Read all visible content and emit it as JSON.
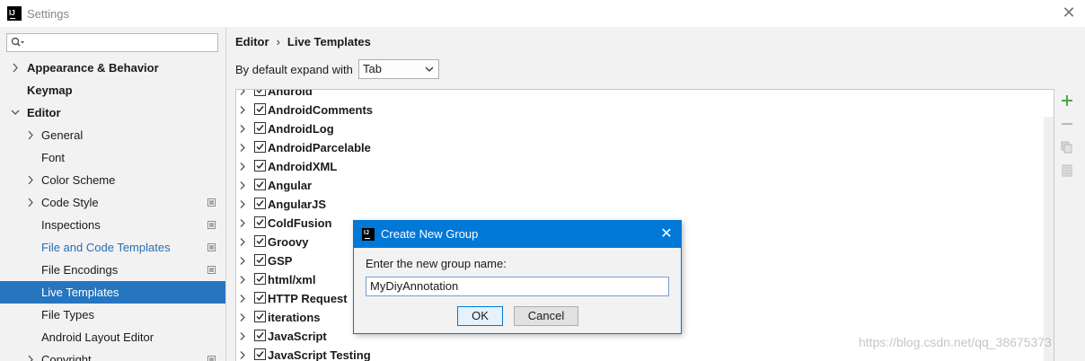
{
  "window": {
    "title": "Settings"
  },
  "sidebar": {
    "search_placeholder": "",
    "items": [
      {
        "label": "Appearance & Behavior",
        "bold": true,
        "expandable": true,
        "expanded": false,
        "indent": 0
      },
      {
        "label": "Keymap",
        "bold": true,
        "expandable": false,
        "indent": 0
      },
      {
        "label": "Editor",
        "bold": true,
        "expandable": true,
        "expanded": true,
        "indent": 0
      },
      {
        "label": "General",
        "expandable": true,
        "expanded": false,
        "indent": 1
      },
      {
        "label": "Font",
        "expandable": false,
        "indent": 1
      },
      {
        "label": "Color Scheme",
        "expandable": true,
        "expanded": false,
        "indent": 1
      },
      {
        "label": "Code Style",
        "expandable": true,
        "expanded": false,
        "indent": 1,
        "project_icon": true
      },
      {
        "label": "Inspections",
        "expandable": false,
        "indent": 1,
        "project_icon": true
      },
      {
        "label": "File and Code Templates",
        "expandable": false,
        "indent": 1,
        "project_icon": true,
        "link": true
      },
      {
        "label": "File Encodings",
        "expandable": false,
        "indent": 1,
        "project_icon": true
      },
      {
        "label": "Live Templates",
        "expandable": false,
        "indent": 1,
        "selected": true
      },
      {
        "label": "File Types",
        "expandable": false,
        "indent": 1
      },
      {
        "label": "Android Layout Editor",
        "expandable": false,
        "indent": 1
      },
      {
        "label": "Copyright",
        "expandable": true,
        "expanded": false,
        "indent": 1,
        "project_icon": true
      }
    ]
  },
  "main": {
    "breadcrumb": [
      "Editor",
      "Live Templates"
    ],
    "breadcrumb_separator": "›",
    "expand_label": "By default expand with",
    "expand_value": "Tab",
    "templates": [
      {
        "name": "Android",
        "checked": true
      },
      {
        "name": "AndroidComments",
        "checked": true
      },
      {
        "name": "AndroidLog",
        "checked": true
      },
      {
        "name": "AndroidParcelable",
        "checked": true
      },
      {
        "name": "AndroidXML",
        "checked": true
      },
      {
        "name": "Angular",
        "checked": true
      },
      {
        "name": "AngularJS",
        "checked": true
      },
      {
        "name": "ColdFusion",
        "checked": true
      },
      {
        "name": "Groovy",
        "checked": true
      },
      {
        "name": "GSP",
        "checked": true
      },
      {
        "name": "html/xml",
        "checked": true
      },
      {
        "name": "HTTP Request",
        "checked": true
      },
      {
        "name": "iterations",
        "checked": true
      },
      {
        "name": "JavaScript",
        "checked": true
      },
      {
        "name": "JavaScript Testing",
        "checked": true
      }
    ],
    "toolbar": [
      "add-icon",
      "remove-icon",
      "copy-icon",
      "restore-icon"
    ]
  },
  "dialog": {
    "title": "Create New Group",
    "label": "Enter the new group name:",
    "input_value": "MyDiyAnnotation",
    "ok_label": "OK",
    "cancel_label": "Cancel"
  },
  "watermark": "https://blog.csdn.net/qq_38675373",
  "colors": {
    "selection": "#2675bf",
    "dialog_title": "#0078d7",
    "add_icon": "#4ca64c"
  }
}
